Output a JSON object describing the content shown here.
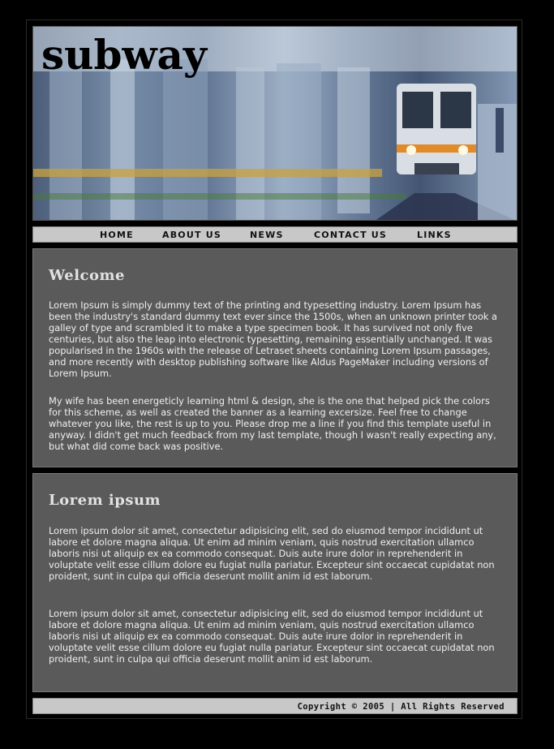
{
  "header": {
    "site_title": "subway"
  },
  "nav": {
    "items": [
      {
        "label": "HOME"
      },
      {
        "label": "ABOUT US"
      },
      {
        "label": "NEWS"
      },
      {
        "label": "CONTACT US"
      },
      {
        "label": "LINKS"
      }
    ]
  },
  "sections": [
    {
      "title": "Welcome",
      "paragraphs": [
        "Lorem Ipsum is simply dummy text of the printing and typesetting industry. Lorem Ipsum has been the industry's standard dummy text ever since the 1500s, when an unknown printer took a galley of type and scrambled it to make a type specimen book. It has survived not only five centuries, but also the leap into electronic typesetting, remaining essentially unchanged. It was popularised in the 1960s with the release of Letraset sheets containing Lorem Ipsum passages, and more recently with desktop publishing software like Aldus PageMaker including versions of Lorem Ipsum.",
        "My wife has been energeticly learning html & design, she is the one that helped pick the colors for this scheme, as well as created the banner as a learning excersize. Feel free to change whatever you like, the rest is up to you. Please drop me a line if you find this template useful in anyway. I didn't get much feedback from my last template, though I wasn't really expecting any, but what did come back was positive."
      ]
    },
    {
      "title": "Lorem ipsum",
      "paragraphs": [
        "Lorem ipsum dolor sit amet, consectetur adipisicing elit, sed do eiusmod tempor incididunt ut labore et dolore magna aliqua. Ut enim ad minim veniam, quis nostrud exercitation ullamco laboris nisi ut aliquip ex ea commodo consequat. Duis aute irure dolor in reprehenderit in voluptate velit esse cillum dolore eu fugiat nulla pariatur. Excepteur sint occaecat cupidatat non proident, sunt in culpa qui officia deserunt mollit anim id est laborum.",
        "Lorem ipsum dolor sit amet, consectetur adipisicing elit, sed do eiusmod tempor incididunt ut labore et dolore magna aliqua. Ut enim ad minim veniam, quis nostrud exercitation ullamco laboris nisi ut aliquip ex ea commodo consequat. Duis aute irure dolor in reprehenderit in voluptate velit esse cillum dolore eu fugiat nulla pariatur. Excepteur sint occaecat cupidatat non proident, sunt in culpa qui officia deserunt mollit anim id est laborum."
      ]
    }
  ],
  "footer": {
    "copyright": "Copyright © 2005 | All Rights Reserved"
  },
  "colors": {
    "page_background": "#000000",
    "panel_background": "#5a5a5a",
    "nav_background": "#c8c8c8",
    "heading_text": "#e2e2e2",
    "body_text": "#efefef"
  }
}
